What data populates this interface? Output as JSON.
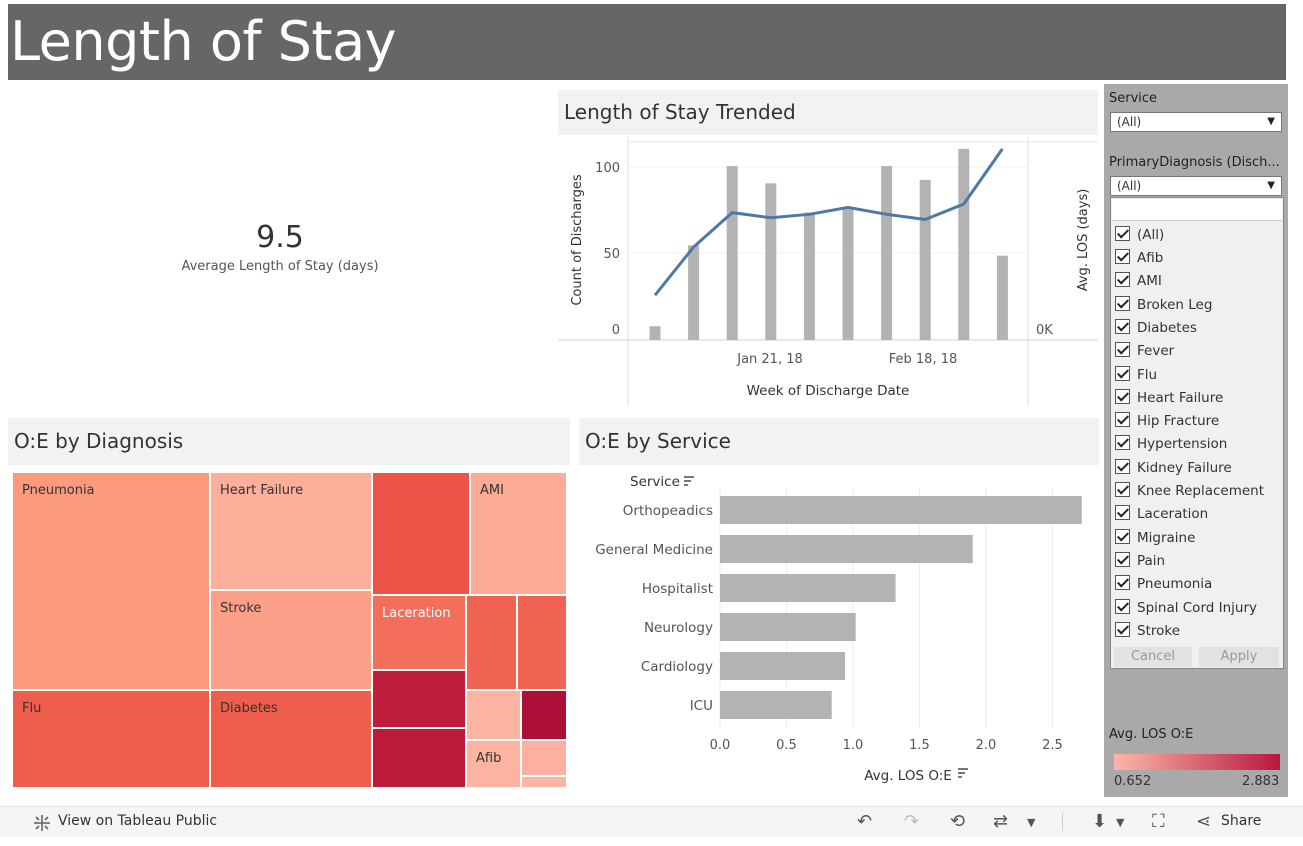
{
  "header": {
    "title": "Length of Stay"
  },
  "kpi": {
    "value": "9.5",
    "label": "Average Length of Stay (days)"
  },
  "trend": {
    "title": "Length of Stay Trended",
    "ylabel_left": "Count of Discharges",
    "ylabel_right": "Avg. LOS (days)",
    "xlabel": "Week of Discharge Date",
    "right_tick": "0K",
    "y_ticks": [
      "0",
      "50",
      "100"
    ],
    "x_ticks": [
      "Jan 21, 18",
      "Feb 18, 18"
    ]
  },
  "treemap": {
    "title": "O:E by Diagnosis",
    "labels": {
      "pneumonia": "Pneumonia",
      "heart_failure": "Heart Failure",
      "ami": "AMI",
      "stroke": "Stroke",
      "laceration": "Laceration",
      "flu": "Flu",
      "diabetes": "Diabetes",
      "afib": "Afib"
    }
  },
  "service_chart": {
    "title": "O:E by Service",
    "header": "Service",
    "xlabel": "Avg. LOS O:E",
    "x_ticks": [
      "0.0",
      "0.5",
      "1.0",
      "1.5",
      "2.0",
      "2.5"
    ]
  },
  "filters": {
    "service_label": "Service",
    "service_value": "(All)",
    "diagnosis_label": "PrimaryDiagnosis (Disch...",
    "diagnosis_value": "(All)",
    "items": [
      "(All)",
      "Afib",
      "AMI",
      "Broken Leg",
      "Diabetes",
      "Fever",
      "Flu",
      "Heart Failure",
      "Hip Fracture",
      "Hypertension",
      "Kidney Failure",
      "Knee Replacement",
      "Laceration",
      "Migraine",
      "Pain",
      "Pneumonia",
      "Spinal Cord Injury",
      "Stroke"
    ],
    "cancel": "Cancel",
    "apply": "Apply"
  },
  "legend": {
    "title": "Avg. LOS O:E",
    "min": "0.652",
    "max": "2.883",
    "color_low": "#fbb7a6",
    "color_high": "#b81840"
  },
  "toolbar": {
    "view_on": "View on Tableau Public",
    "share": "Share"
  },
  "colors": {
    "header_bg": "#666666",
    "bar_gray": "#b3b3b3",
    "line_blue": "#4e79a7",
    "filter_bg": "#a9a9a9"
  },
  "chart_data": [
    {
      "type": "bar",
      "title": "Length of Stay Trended",
      "xlabel": "Week of Discharge Date",
      "ylabel": "Count of Discharges",
      "ylim": [
        0,
        115
      ],
      "series": [
        {
          "values": [
            8,
            55,
            101,
            91,
            74,
            76,
            101,
            93,
            111,
            49
          ]
        },
        {
          "type": "line",
          "axis": "right",
          "values": [
            26,
            54,
            74,
            71,
            73,
            77,
            73,
            70,
            79,
            111
          ]
        }
      ]
    },
    {
      "type": "bar",
      "title": "O:E by Service",
      "xlabel": "Avg. LOS O:E",
      "categories": [
        "Orthopeadics",
        "General Medicine",
        "Hospitalist",
        "Neurology",
        "Cardiology",
        "ICU"
      ],
      "values": [
        2.72,
        1.9,
        1.32,
        1.02,
        0.94,
        0.84
      ],
      "xlim": [
        0,
        2.8
      ]
    }
  ]
}
